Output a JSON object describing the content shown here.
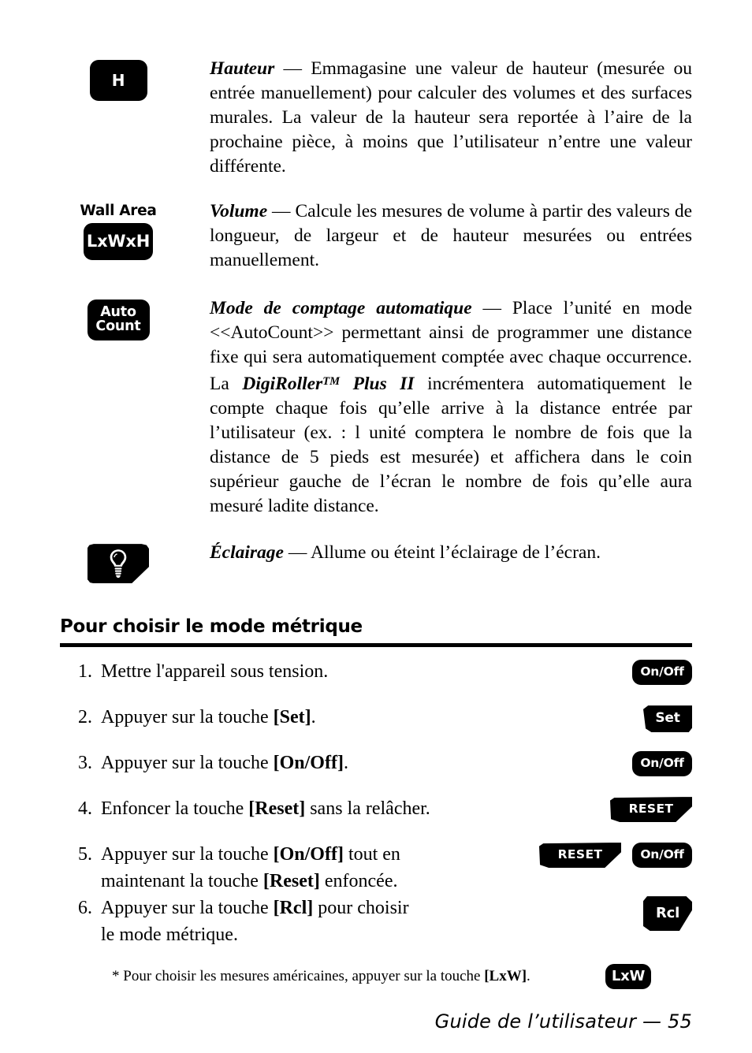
{
  "features": [
    {
      "key": {
        "type": "rect",
        "label": "H",
        "name": "key-height"
      },
      "above_label": "",
      "paragraphs": [
        {
          "term": "Hauteur",
          "dash": " — ",
          "text": "Emmagasine une valeur de hauteur (mesurée ou entrée manuellement) pour calculer des volumes et des surfaces murales. La valeur de la hauteur sera reportée à l’aire de la prochaine pièce, à moins que l’utilisateur n’entre une valeur différente."
        }
      ]
    },
    {
      "key": {
        "type": "rect",
        "label": "LxWxH",
        "name": "key-wall-area"
      },
      "above_label": "Wall Area",
      "paragraphs": [
        {
          "term": "Volume",
          "dash": " — ",
          "text": "Calcule les mesures de volume à partir des valeurs de longueur, de largeur et de hauteur mesurées ou entrées manuellement."
        }
      ]
    },
    {
      "key": {
        "type": "rect-stacked",
        "label_line1": "Auto",
        "label_line2": "Count",
        "name": "key-auto-count"
      },
      "above_label": "",
      "paragraphs": [
        {
          "term": "Mode de comptage automatique",
          "dash": " — ",
          "text_before_brand": "Place l’unité en mode <<AutoCount>> permettant ainsi de programmer une distance fixe qui sera automatiquement comptée avec chaque occurrence. La ",
          "brand": "DigiRoller",
          "brand_tm": "TM",
          "brand_suffix": " Plus II",
          "text_after_brand": " incrémentera automatiquement le compte chaque fois qu’elle arrive à la distance entrée par l’utilisateur (ex. : l unité comptera le nombre de fois que la distance de 5 pieds est mesurée) et affichera dans le coin supérieur gauche de l’écran le nombre de fois qu’elle aura mesuré ladite distance."
        }
      ]
    },
    {
      "key": {
        "type": "angled-icon",
        "icon": "lightbulb-icon",
        "name": "key-light"
      },
      "above_label": "",
      "paragraphs": [
        {
          "term": "Éclairage",
          "dash": " — ",
          "text": "Allume ou éteint l’éclairage de l’écran."
        }
      ]
    }
  ],
  "section": {
    "title": "Pour choisir le mode métrique",
    "steps": [
      {
        "number": "1.",
        "text_parts": [
          {
            "t": "Mettre l'appareil sous tension.",
            "bold": false
          }
        ],
        "keys": [
          {
            "label": "On/Off",
            "style": "onoff",
            "name": "key-on-off"
          }
        ]
      },
      {
        "number": "2.",
        "text_parts": [
          {
            "t": "Appuyer sur la touche ",
            "bold": false
          },
          {
            "t": "[Set]",
            "bold": true
          },
          {
            "t": ".",
            "bold": false
          }
        ],
        "keys": [
          {
            "label": "Set",
            "style": "set",
            "name": "key-set"
          }
        ]
      },
      {
        "number": "3.",
        "text_parts": [
          {
            "t": "Appuyer sur la touche ",
            "bold": false
          },
          {
            "t": "[On/Off]",
            "bold": true
          },
          {
            "t": ".",
            "bold": false
          }
        ],
        "keys": [
          {
            "label": "On/Off",
            "style": "onoff",
            "name": "key-on-off"
          }
        ]
      },
      {
        "number": "4.",
        "text_parts": [
          {
            "t": "Enfoncer la touche ",
            "bold": false
          },
          {
            "t": "[Reset]",
            "bold": true
          },
          {
            "t": " sans la relâcher.",
            "bold": false
          }
        ],
        "keys": [
          {
            "label": "RESET",
            "style": "reset",
            "name": "key-reset"
          }
        ]
      },
      {
        "number": "5.",
        "text_parts": [
          {
            "t": "Appuyer sur la touche ",
            "bold": false
          },
          {
            "t": "[On/Off]",
            "bold": true
          },
          {
            "t": " tout en",
            "bold": false
          },
          {
            "t": "\n",
            "bold": false
          },
          {
            "t": "maintenant la touche ",
            "bold": false
          },
          {
            "t": "[Reset]",
            "bold": true
          },
          {
            "t": " enfoncée.",
            "bold": false
          }
        ],
        "keys": [
          {
            "label": "RESET",
            "style": "reset",
            "name": "key-reset"
          },
          {
            "label": "On/Off",
            "style": "onoff",
            "name": "key-on-off"
          }
        ]
      },
      {
        "number": "6.",
        "text_parts": [
          {
            "t": "Appuyer sur la touche ",
            "bold": false
          },
          {
            "t": "[Rcl]",
            "bold": true
          },
          {
            "t": " pour choisir",
            "bold": false
          },
          {
            "t": "\n",
            "bold": false
          },
          {
            "t": "le mode métrique.",
            "bold": false
          }
        ],
        "keys": [
          {
            "label": "Rcl",
            "style": "rcl",
            "name": "key-rcl"
          }
        ]
      }
    ],
    "footnote": {
      "prefix": "* Pour choisir les mesures américaines, appuyer sur la touche ",
      "bold": "[LxW]",
      "suffix": ".",
      "key": {
        "label": "LxW",
        "style": "lxw",
        "name": "key-lxw"
      }
    }
  },
  "footer": {
    "text": "Guide de l’utilisateur  — 55"
  },
  "colors": {
    "key_background": "#000000",
    "key_text": "#ffffff",
    "page_background": "#ffffff",
    "body_text": "#000000"
  }
}
